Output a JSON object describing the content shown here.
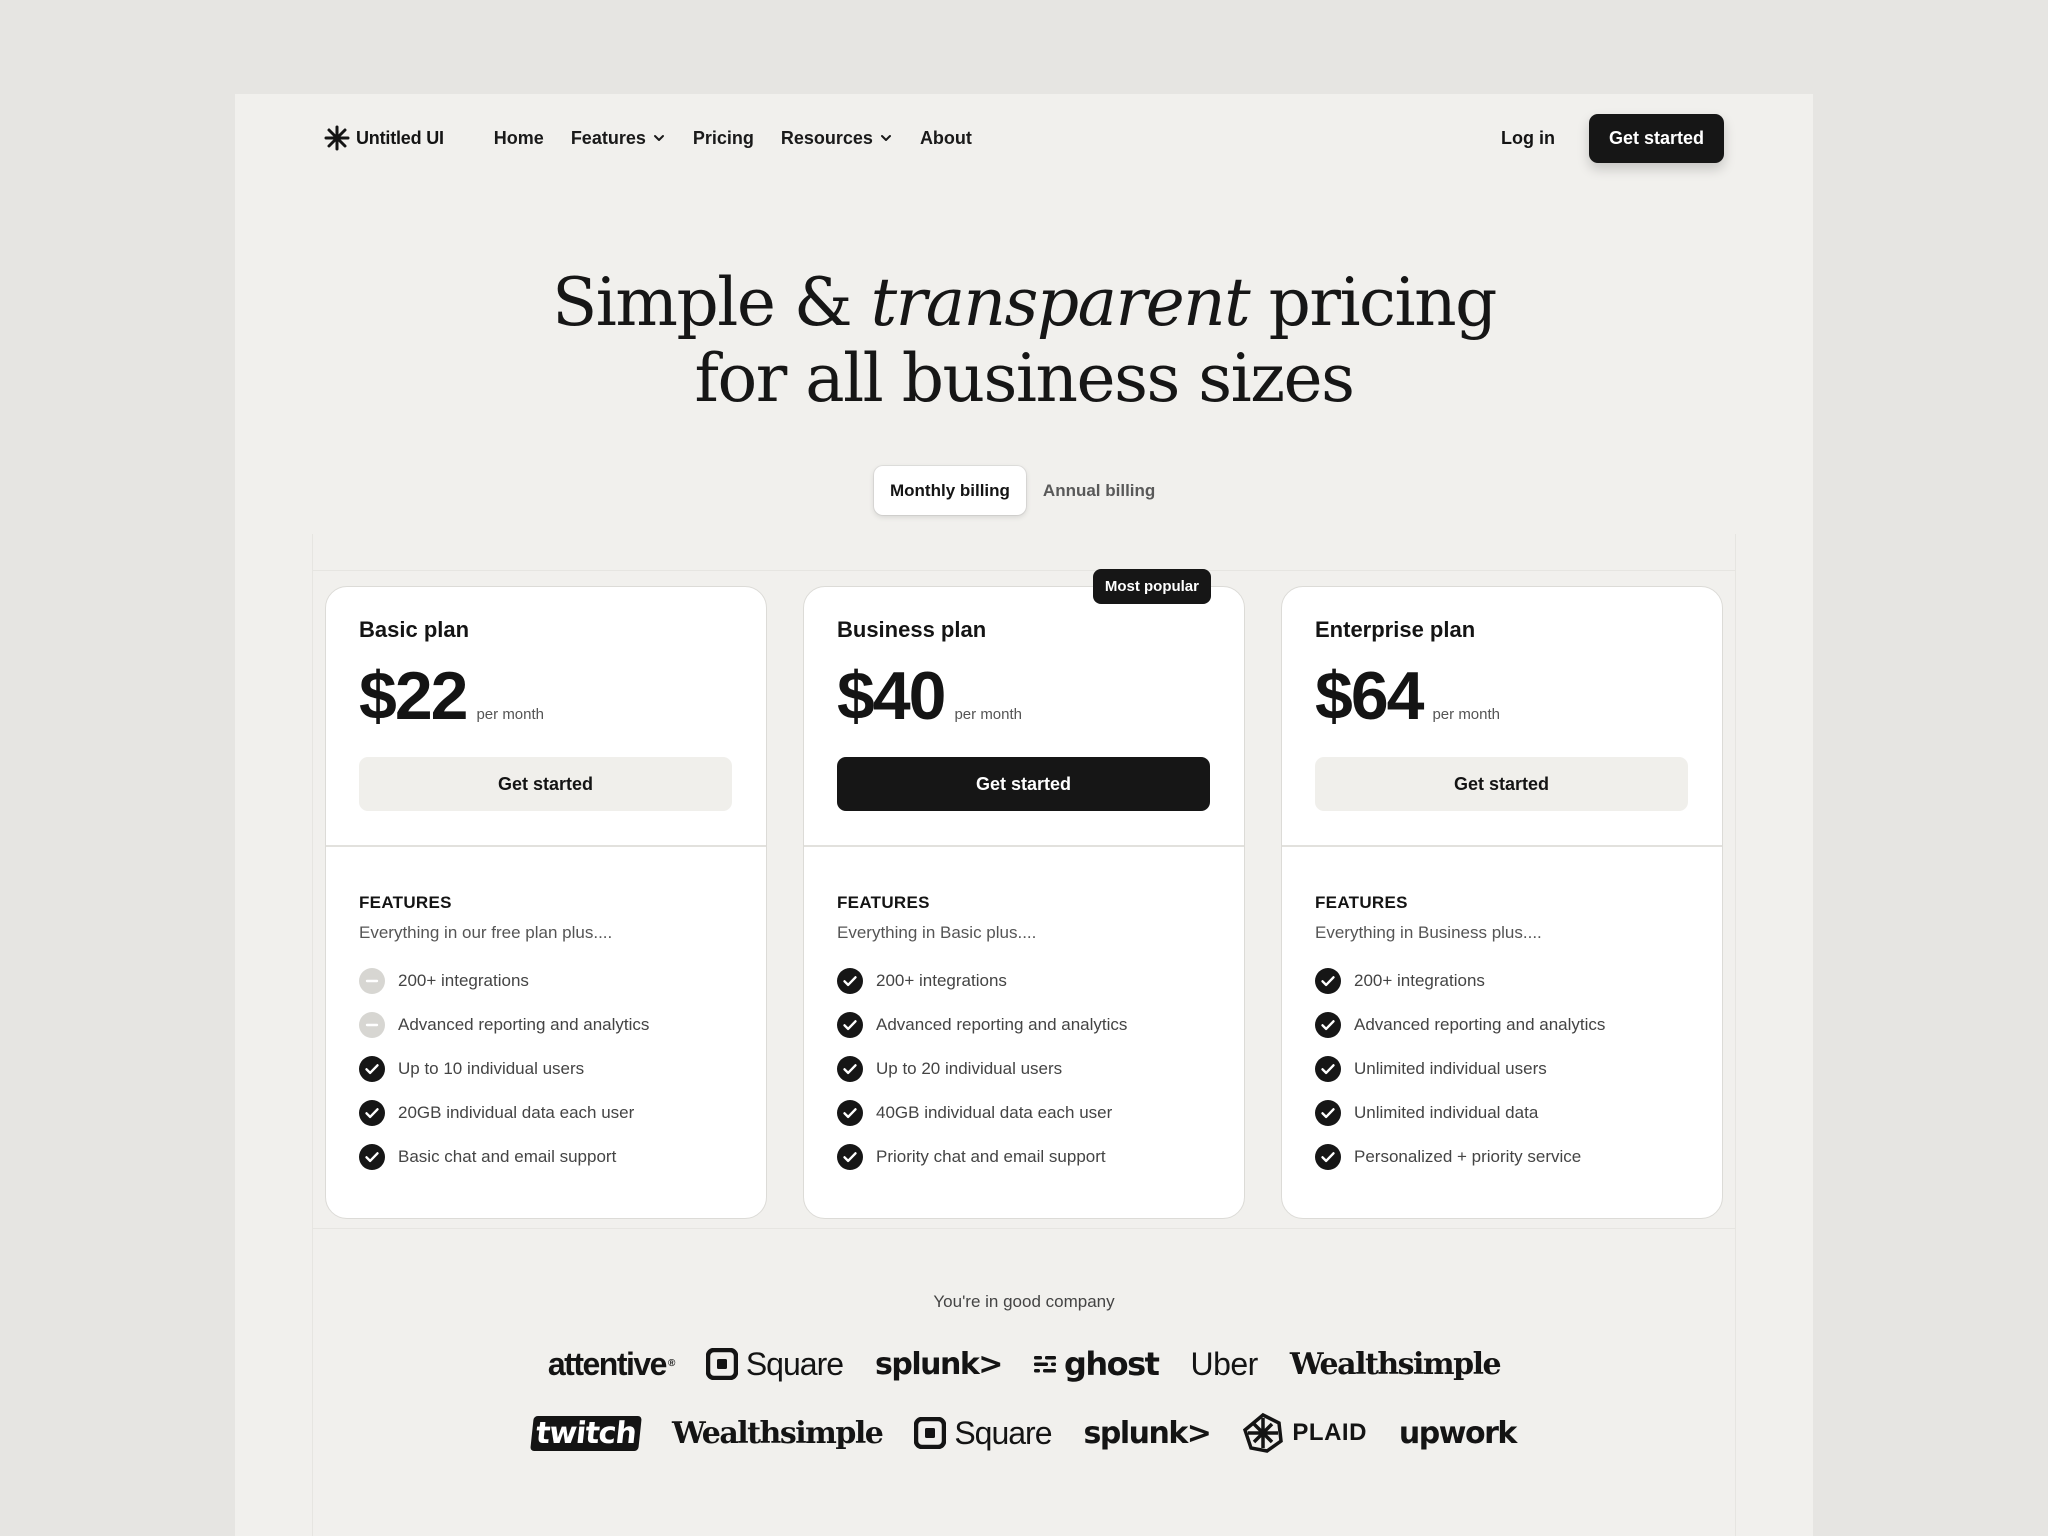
{
  "nav": {
    "logo": "Untitled UI",
    "links": [
      {
        "label": "Home",
        "dropdown": false
      },
      {
        "label": "Features",
        "dropdown": true
      },
      {
        "label": "Pricing",
        "dropdown": false
      },
      {
        "label": "Resources",
        "dropdown": true
      },
      {
        "label": "About",
        "dropdown": false
      }
    ],
    "login": "Log in",
    "cta": "Get started"
  },
  "hero": {
    "line1_a": "Simple & ",
    "line1_em": "transparent",
    "line1_b": " pricing",
    "line2": "for all business sizes"
  },
  "billing": {
    "monthly": "Monthly billing",
    "annual": "Annual billing",
    "selected": "Monthly billing"
  },
  "plans": [
    {
      "name": "Basic plan",
      "price": "$22",
      "period": "per month",
      "cta": "Get started",
      "cta_style": "light",
      "features_heading": "FEATURES",
      "features_sub": "Everything in our free plan plus....",
      "features": [
        {
          "text": "200+ integrations",
          "included": false
        },
        {
          "text": "Advanced reporting and analytics",
          "included": false
        },
        {
          "text": "Up to 10 individual users",
          "included": true
        },
        {
          "text": "20GB individual data each user",
          "included": true
        },
        {
          "text": "Basic chat and email support",
          "included": true
        }
      ]
    },
    {
      "name": "Business plan",
      "badge": "Most popular",
      "price": "$40",
      "period": "per month",
      "cta": "Get started",
      "cta_style": "dark",
      "features_heading": "FEATURES",
      "features_sub": "Everything in Basic plus....",
      "features": [
        {
          "text": "200+ integrations",
          "included": true
        },
        {
          "text": "Advanced reporting and analytics",
          "included": true
        },
        {
          "text": "Up to 20 individual users",
          "included": true
        },
        {
          "text": "40GB individual data each user",
          "included": true
        },
        {
          "text": "Priority chat and email support",
          "included": true
        }
      ]
    },
    {
      "name": "Enterprise plan",
      "price": "$64",
      "period": "per month",
      "cta": "Get started",
      "cta_style": "light",
      "features_heading": "FEATURES",
      "features_sub": "Everything in Business plus....",
      "features": [
        {
          "text": "200+ integrations",
          "included": true
        },
        {
          "text": "Advanced reporting and analytics",
          "included": true
        },
        {
          "text": "Unlimited individual users",
          "included": true
        },
        {
          "text": "Unlimited individual data",
          "included": true
        },
        {
          "text": "Personalized + priority service",
          "included": true
        }
      ]
    }
  ],
  "companies": {
    "heading": "You're in good company",
    "row1": [
      "attentive",
      "Square",
      "splunk>",
      "ghost",
      "Uber",
      "Wealthsimple"
    ],
    "row2": [
      "twitch",
      "Wealthsimple",
      "Square",
      "splunk>",
      "PLAID",
      "upwork"
    ]
  }
}
